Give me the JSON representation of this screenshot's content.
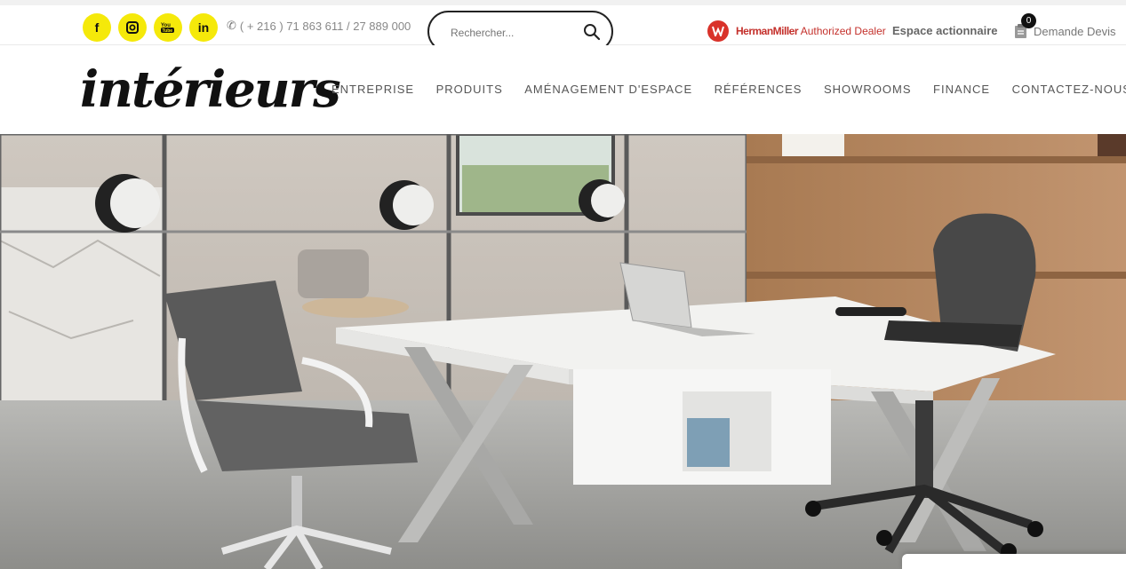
{
  "topbar": {
    "socials": [
      {
        "name": "facebook-icon",
        "glyph": "f"
      },
      {
        "name": "instagram-icon",
        "glyph": "◘"
      },
      {
        "name": "youtube-icon",
        "glyph": "▶"
      },
      {
        "name": "linkedin-icon",
        "glyph": "in"
      }
    ],
    "phone": "( + 216 ) 71 863 611 / 27 889 000",
    "search_placeholder": "Rechercher...",
    "dealer_brand": "HermanMiller",
    "dealer_text": "Authorized Dealer",
    "espace": "Espace actionnaire",
    "cart_count": "0",
    "devis": "Demande Devis"
  },
  "header": {
    "logo": "intérieurs",
    "nav": [
      "ENTREPRISE",
      "PRODUITS",
      "AMÉNAGEMENT D'ESPACE",
      "RÉFÉRENCES",
      "SHOWROOMS",
      "FINANCE",
      "CONTACTEZ-NOUS"
    ]
  },
  "colors": {
    "social_yellow": "#f5e90a",
    "dealer_red": "#d9322a"
  }
}
